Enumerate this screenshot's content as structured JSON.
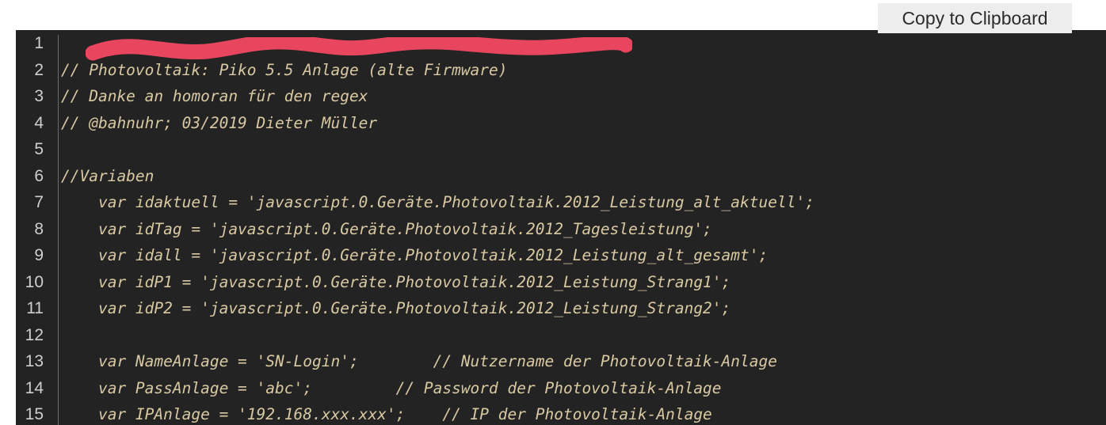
{
  "toolbar": {
    "copy_label": "Copy to Clipboard"
  },
  "editor": {
    "background_color": "#232323",
    "comment_color": "#d8c9a3",
    "gutter_color": "#cfcfcf",
    "redaction_color": "#e8465e",
    "redaction_line": 1,
    "lines": [
      {
        "n": "1",
        "text": ""
      },
      {
        "n": "2",
        "text": "// Photovoltaik: Piko 5.5 Anlage (alte Firmware)"
      },
      {
        "n": "3",
        "text": "// Danke an homoran für den regex"
      },
      {
        "n": "4",
        "text": "// @bahnuhr; 03/2019 Dieter Müller"
      },
      {
        "n": "5",
        "text": ""
      },
      {
        "n": "6",
        "text": "//Variaben"
      },
      {
        "n": "7",
        "text": "    var idaktuell = 'javascript.0.Geräte.Photovoltaik.2012_Leistung_alt_aktuell';"
      },
      {
        "n": "8",
        "text": "    var idTag = 'javascript.0.Geräte.Photovoltaik.2012_Tagesleistung';"
      },
      {
        "n": "9",
        "text": "    var idall = 'javascript.0.Geräte.Photovoltaik.2012_Leistung_alt_gesamt';"
      },
      {
        "n": "10",
        "text": "    var idP1 = 'javascript.0.Geräte.Photovoltaik.2012_Leistung_Strang1';"
      },
      {
        "n": "11",
        "text": "    var idP2 = 'javascript.0.Geräte.Photovoltaik.2012_Leistung_Strang2';"
      },
      {
        "n": "12",
        "text": ""
      },
      {
        "n": "13",
        "text": "    var NameAnlage = 'SN-Login';        // Nutzername der Photovoltaik-Anlage"
      },
      {
        "n": "14",
        "text": "    var PassAnlage = 'abc';         // Password der Photovoltaik-Anlage"
      },
      {
        "n": "15",
        "text": "    var IPAnlage = '192.168.xxx.xxx';    // IP der Photovoltaik-Anlage"
      }
    ]
  }
}
